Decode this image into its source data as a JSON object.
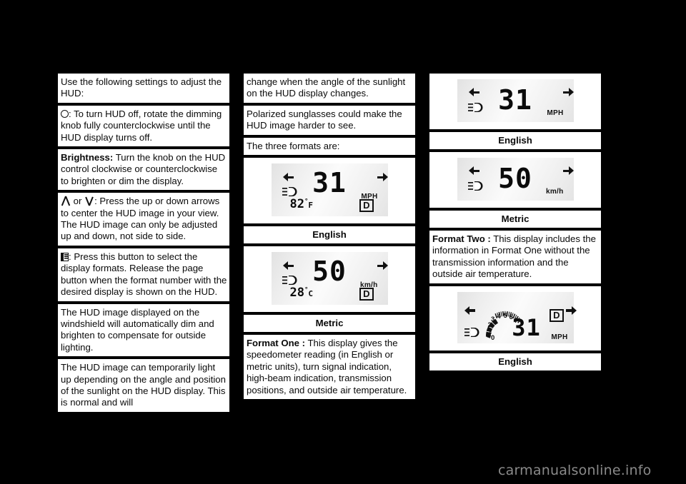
{
  "page": {
    "background_color": "#000000",
    "watermark": "carmanualsonline.info"
  },
  "column1": {
    "blocks": [
      {
        "id": "intro",
        "text": "Use the following settings to adjust the HUD:"
      },
      {
        "id": "dimmer",
        "icon": "circle-knob-icon",
        "text": ": To turn HUD off, rotate the dimming knob fully counterclockwise until the HUD display turns off."
      },
      {
        "id": "brightness",
        "label": "Brightness:",
        "text": " Turn the knob on the HUD control clockwise or counterclockwise to brighten or dim the display."
      },
      {
        "id": "updown",
        "icon_up": "up-arrow-icon",
        "joiner": " or ",
        "icon_down": "down-arrow-icon",
        "text": ": Press the up or down arrows to center the HUD image in your view. The HUD image can only be adjusted up and down, not side to side."
      },
      {
        "id": "page",
        "icon": "page-button-icon",
        "text": ": Press this button to select the display formats. Release the page button when the format number with the desired display is shown on the HUD."
      },
      {
        "id": "autodim",
        "text": "The HUD image displayed on the windshield will automatically dim and brighten to compensate for outside lighting."
      },
      {
        "id": "sunlight",
        "text": "The HUD image can temporarily light up depending on the angle and position of the sunlight on the HUD display. This is normal and will"
      }
    ]
  },
  "column2": {
    "blocks": [
      {
        "id": "sunlight-cont",
        "text": "change when the angle of the sunlight on the HUD display changes."
      },
      {
        "id": "polarized",
        "text": "Polarized sunglasses could make the HUD image harder to see."
      },
      {
        "id": "formats-intro",
        "text": "The three formats are:"
      }
    ],
    "figure_english": {
      "name": "hud-format-one-english",
      "turn_left": "left-turn-arrow-icon",
      "turn_right": "right-turn-arrow-icon",
      "high_beam": "high-beam-icon",
      "speed": "31",
      "units": "MPH",
      "temperature": "82",
      "temperature_unit": "F",
      "temperature_degree": "°",
      "gear": "D",
      "caption": "English"
    },
    "figure_metric": {
      "name": "hud-format-one-metric",
      "turn_left": "left-turn-arrow-icon",
      "turn_right": "right-turn-arrow-icon",
      "high_beam": "high-beam-icon",
      "speed": "50",
      "units": "km/h",
      "temperature": "28",
      "temperature_unit": "C",
      "temperature_degree": "°",
      "gear": "D",
      "caption": "Metric"
    },
    "format_one": {
      "label": "Format One :",
      "text": " This display gives the speedometer reading (in English or metric units), turn signal indication, high-beam indication, transmission positions, and outside air temperature."
    }
  },
  "column3": {
    "figure_english": {
      "name": "hud-format-two-english",
      "turn_left": "left-turn-arrow-icon",
      "turn_right": "right-turn-arrow-icon",
      "high_beam": "high-beam-icon",
      "speed": "31",
      "units": "MPH",
      "caption": "English"
    },
    "figure_metric": {
      "name": "hud-format-two-metric",
      "turn_left": "left-turn-arrow-icon",
      "turn_right": "right-turn-arrow-icon",
      "high_beam": "high-beam-icon",
      "speed": "50",
      "units": "km/h",
      "caption": "Metric"
    },
    "format_two": {
      "label": "Format Two :",
      "text": " This display includes the information in Format One without the transmission information and the outside air temperature."
    },
    "figure_tach": {
      "name": "hud-format-three-english",
      "turn_left": "left-turn-arrow-icon",
      "turn_right": "right-turn-arrow-icon",
      "high_beam": "high-beam-icon",
      "speed": "31",
      "units": "MPH",
      "gear": "D",
      "tach_labels": [
        "0",
        "1",
        "2",
        "3",
        "4",
        "5",
        "6",
        "7"
      ],
      "caption": "English"
    }
  }
}
